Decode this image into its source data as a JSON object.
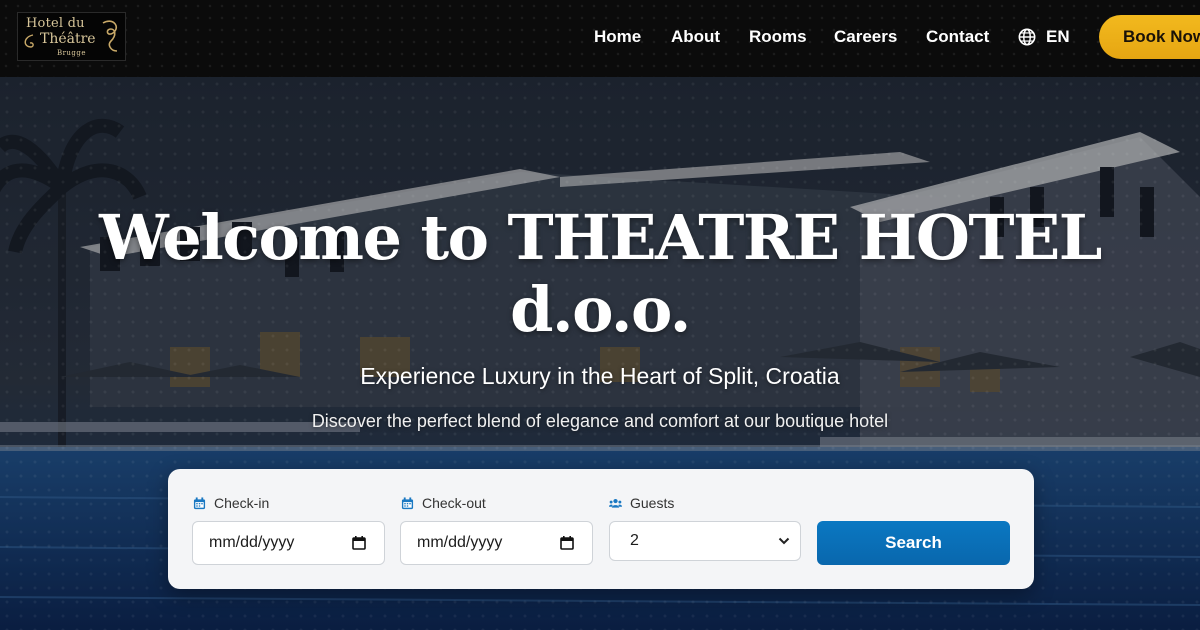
{
  "brand": {
    "logo_line1": "Hotel du",
    "logo_line2": "Théâtre",
    "logo_line3": "Brugge"
  },
  "nav": {
    "items": [
      {
        "label": "Home"
      },
      {
        "label": "About"
      },
      {
        "label": "Rooms"
      },
      {
        "label": "Careers"
      },
      {
        "label": "Contact"
      }
    ],
    "language": "EN",
    "book_label": "Book Now"
  },
  "hero": {
    "title": "Welcome to THEATRE HOTEL d.o.o.",
    "subtitle": "Experience Luxury in the Heart of Split, Croatia",
    "tagline": "Discover the perfect blend of elegance and comfort at our boutique hotel"
  },
  "booking": {
    "checkin_label": "Check-in",
    "checkin_value": "mm/dd/yyyy",
    "checkout_label": "Check-out",
    "checkout_value": "mm/dd/yyyy",
    "guests_label": "Guests",
    "guests_value": "2",
    "search_label": "Search"
  },
  "colors": {
    "accent": "#f2b91e",
    "primary_button": "#0a78c2",
    "header_bg": "#0b0b0b",
    "icon_blue": "#1a78c2"
  },
  "icons": {
    "language": "globe-icon",
    "checkin": "calendar-icon",
    "checkout": "calendar-icon",
    "guests": "users-icon"
  }
}
